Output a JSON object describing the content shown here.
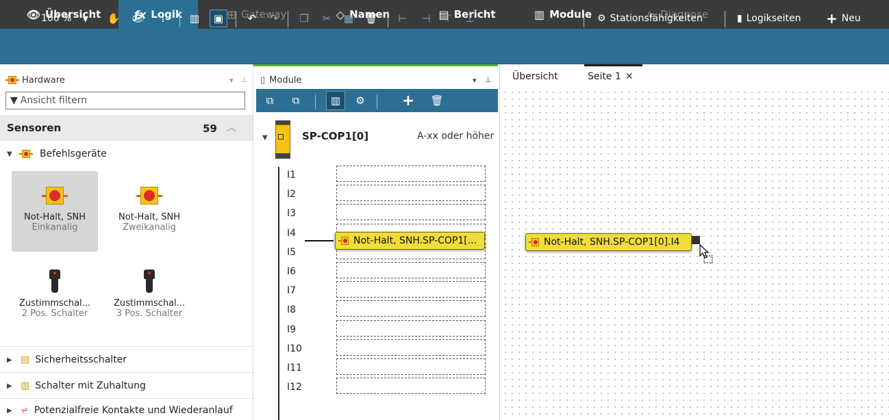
{
  "top_tabs": [
    {
      "label": "Übersicht",
      "icon": "eye-icon",
      "state": "normal"
    },
    {
      "label": "Logik",
      "icon": "logic-fx-icon",
      "state": "active"
    },
    {
      "label": "Gateway",
      "icon": "gateway-icon",
      "state": "disabled"
    },
    {
      "label": "Namen",
      "icon": "tag-icon",
      "state": "normal"
    },
    {
      "label": "Bericht",
      "icon": "document-icon",
      "state": "normal"
    },
    {
      "label": "Module",
      "icon": "modules-icon",
      "state": "normal"
    },
    {
      "label": "Diagnose",
      "icon": "pulse-icon",
      "state": "disabled"
    }
  ],
  "toolbar": {
    "zoom": "100 %",
    "stationsfaehigkeiten_label": "Stationsfähigkeiten",
    "logikseiten_label": "Logikseiten",
    "neu_label": "Neu"
  },
  "hardware_panel": {
    "title": "Hardware",
    "filter_placeholder": "Ansicht filtern",
    "category": {
      "label": "Sensoren",
      "count": "59"
    },
    "group": "Befehlsgeräte",
    "tiles": [
      {
        "title": "Not-Halt, SNH",
        "subtitle": "Einkanalig",
        "selected": true
      },
      {
        "title": "Not-Halt, SNH",
        "subtitle": "Zweikanalig",
        "selected": false
      },
      {
        "title": "Zustimmschal...",
        "subtitle": "2 Pos. Schalter",
        "selected": false
      },
      {
        "title": "Zustimmschal...",
        "subtitle": "3 Pos. Schalter",
        "selected": false
      }
    ],
    "tree_items": [
      "Sicherheitsschalter",
      "Schalter mit Zuhaltung",
      "Potenzialfreie Kontakte und Wiederanlauf"
    ]
  },
  "module_panel": {
    "title": "Module",
    "module_name": "SP-COP1[0]",
    "module_version": "A-xx oder höher",
    "inputs": [
      "I1",
      "I2",
      "I3",
      "I4",
      "I5",
      "I6",
      "I7",
      "I8",
      "I9",
      "I10",
      "I11",
      "I12"
    ],
    "assigned_chip": "Not-Halt, SNH.SP-COP1[..."
  },
  "canvas": {
    "tabs": [
      "Übersicht",
      "Seite 1"
    ],
    "element_label": "Not-Halt, SNH.SP-COP1[0].I4"
  },
  "colors": {
    "tabbar": "#3b3b3b",
    "accent": "#2b6f94",
    "chip": "#f0dc3c",
    "green_indicator": "#5cb82b"
  }
}
